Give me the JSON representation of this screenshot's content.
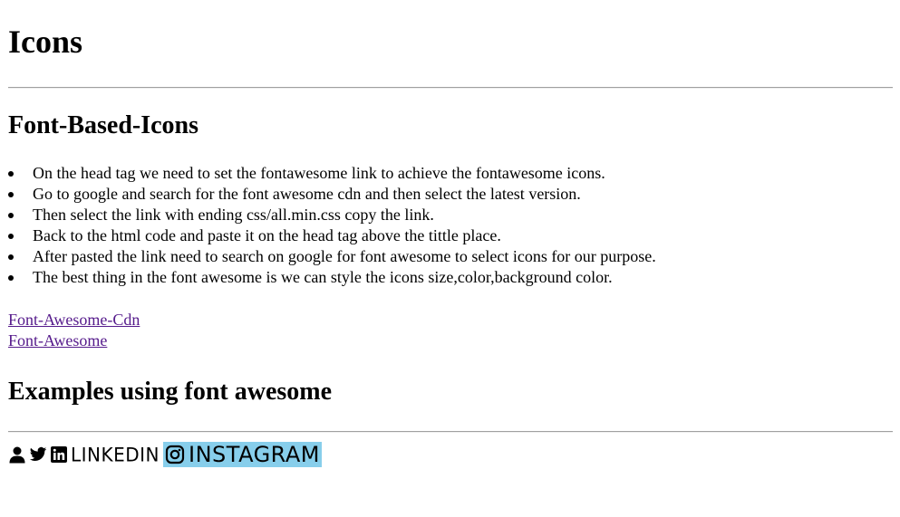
{
  "page": {
    "title": "Icons",
    "section1_title": "Font-Based-Icons",
    "bullets": [
      "On the head tag we need to set the fontawesome link to achieve the fontawesome icons.",
      "Go to google and search for the font awesome cdn and then select the latest version.",
      "Then select the link with ending css/all.min.css copy the link.",
      "Back to the html code and paste it on the head tag above the tittle place.",
      "After pasted the link need to search on google for font awesome to select icons for our purpose.",
      "The best thing in the font awesome is we can style the icons size,color,background color."
    ],
    "links": [
      "Font-Awesome-Cdn",
      "Font-Awesome"
    ],
    "section2_title": "Examples using font awesome",
    "examples": {
      "icons": [
        "user-icon",
        "twitter-icon",
        "linkedin-icon",
        "instagram-icon"
      ],
      "linkedin_label": "LINKEDIN",
      "instagram_label": "INSTAGRAM",
      "instagram_bg": "#87ceeb",
      "link_color": "#551a8b"
    }
  }
}
